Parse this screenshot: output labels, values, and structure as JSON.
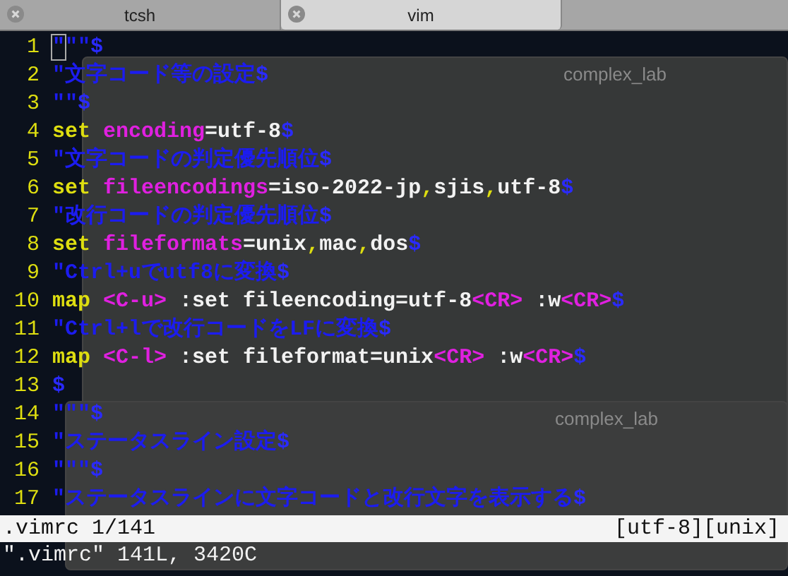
{
  "tabs": [
    {
      "label": "tcsh",
      "selected": false
    },
    {
      "label": "vim",
      "selected": true
    }
  ],
  "background_windows": [
    {
      "title": "complex_lab"
    },
    {
      "title": "complex_lab"
    }
  ],
  "lines": [
    {
      "number": "1",
      "segments": [
        {
          "kind": "cursor",
          "text": "\""
        },
        {
          "kind": "comment",
          "text": "\"\""
        },
        {
          "kind": "eol",
          "text": "$"
        }
      ]
    },
    {
      "number": "2",
      "segments": [
        {
          "kind": "comment",
          "text": "\"文字コード等の設定"
        },
        {
          "kind": "eol",
          "text": "$"
        }
      ]
    },
    {
      "number": "3",
      "segments": [
        {
          "kind": "comment",
          "text": "\"\""
        },
        {
          "kind": "eol",
          "text": "$"
        }
      ]
    },
    {
      "number": "4",
      "segments": [
        {
          "kind": "keyword",
          "text": "set "
        },
        {
          "kind": "option",
          "text": "encoding"
        },
        {
          "kind": "value",
          "text": "=utf-8"
        },
        {
          "kind": "eol",
          "text": "$"
        }
      ]
    },
    {
      "number": "5",
      "segments": [
        {
          "kind": "comment",
          "text": "\"文字コードの判定優先順位"
        },
        {
          "kind": "eol",
          "text": "$"
        }
      ]
    },
    {
      "number": "6",
      "segments": [
        {
          "kind": "keyword",
          "text": "set "
        },
        {
          "kind": "option",
          "text": "fileencodings"
        },
        {
          "kind": "value",
          "text": "=iso-2022-jp"
        },
        {
          "kind": "keyword",
          "text": ","
        },
        {
          "kind": "value",
          "text": "sjis"
        },
        {
          "kind": "keyword",
          "text": ","
        },
        {
          "kind": "value",
          "text": "utf-8"
        },
        {
          "kind": "eol",
          "text": "$"
        }
      ]
    },
    {
      "number": "7",
      "segments": [
        {
          "kind": "comment",
          "text": "\"改行コードの判定優先順位"
        },
        {
          "kind": "eol",
          "text": "$"
        }
      ]
    },
    {
      "number": "8",
      "segments": [
        {
          "kind": "keyword",
          "text": "set "
        },
        {
          "kind": "option",
          "text": "fileformats"
        },
        {
          "kind": "value",
          "text": "=unix"
        },
        {
          "kind": "keyword",
          "text": ","
        },
        {
          "kind": "value",
          "text": "mac"
        },
        {
          "kind": "keyword",
          "text": ","
        },
        {
          "kind": "value",
          "text": "dos"
        },
        {
          "kind": "eol",
          "text": "$"
        }
      ]
    },
    {
      "number": "9",
      "segments": [
        {
          "kind": "comment",
          "text": "\"Ctrl+uでutf8に変換"
        },
        {
          "kind": "eol",
          "text": "$"
        }
      ]
    },
    {
      "number": "10",
      "segments": [
        {
          "kind": "keyword",
          "text": "map "
        },
        {
          "kind": "option",
          "text": "<C-u>"
        },
        {
          "kind": "value",
          "text": " :set fileencoding=utf-8"
        },
        {
          "kind": "option",
          "text": "<CR>"
        },
        {
          "kind": "value",
          "text": " :w"
        },
        {
          "kind": "option",
          "text": "<CR>"
        },
        {
          "kind": "eol",
          "text": "$"
        }
      ]
    },
    {
      "number": "11",
      "segments": [
        {
          "kind": "comment",
          "text": "\"Ctrl+lで改行コードをLFに変換"
        },
        {
          "kind": "eol",
          "text": "$"
        }
      ]
    },
    {
      "number": "12",
      "segments": [
        {
          "kind": "keyword",
          "text": "map "
        },
        {
          "kind": "option",
          "text": "<C-l>"
        },
        {
          "kind": "value",
          "text": " :set fileformat=unix"
        },
        {
          "kind": "option",
          "text": "<CR>"
        },
        {
          "kind": "value",
          "text": " :w"
        },
        {
          "kind": "option",
          "text": "<CR>"
        },
        {
          "kind": "eol",
          "text": "$"
        }
      ]
    },
    {
      "number": "13",
      "segments": [
        {
          "kind": "eol",
          "text": "$"
        }
      ]
    },
    {
      "number": "14",
      "segments": [
        {
          "kind": "comment",
          "text": "\"\"\""
        },
        {
          "kind": "eol",
          "text": "$"
        }
      ]
    },
    {
      "number": "15",
      "segments": [
        {
          "kind": "comment",
          "text": "\"ステータスライン設定"
        },
        {
          "kind": "eol",
          "text": "$"
        }
      ]
    },
    {
      "number": "16",
      "segments": [
        {
          "kind": "comment",
          "text": "\"\"\""
        },
        {
          "kind": "eol",
          "text": "$"
        }
      ]
    },
    {
      "number": "17",
      "segments": [
        {
          "kind": "comment",
          "text": "\"ステータスラインに文字コードと改行文字を表示する"
        },
        {
          "kind": "eol",
          "text": "$"
        }
      ]
    }
  ],
  "status_line": {
    "left": ".vimrc 1/141",
    "right": "[utf-8][unix]"
  },
  "message": "\".vimrc\" 141L, 3420C"
}
